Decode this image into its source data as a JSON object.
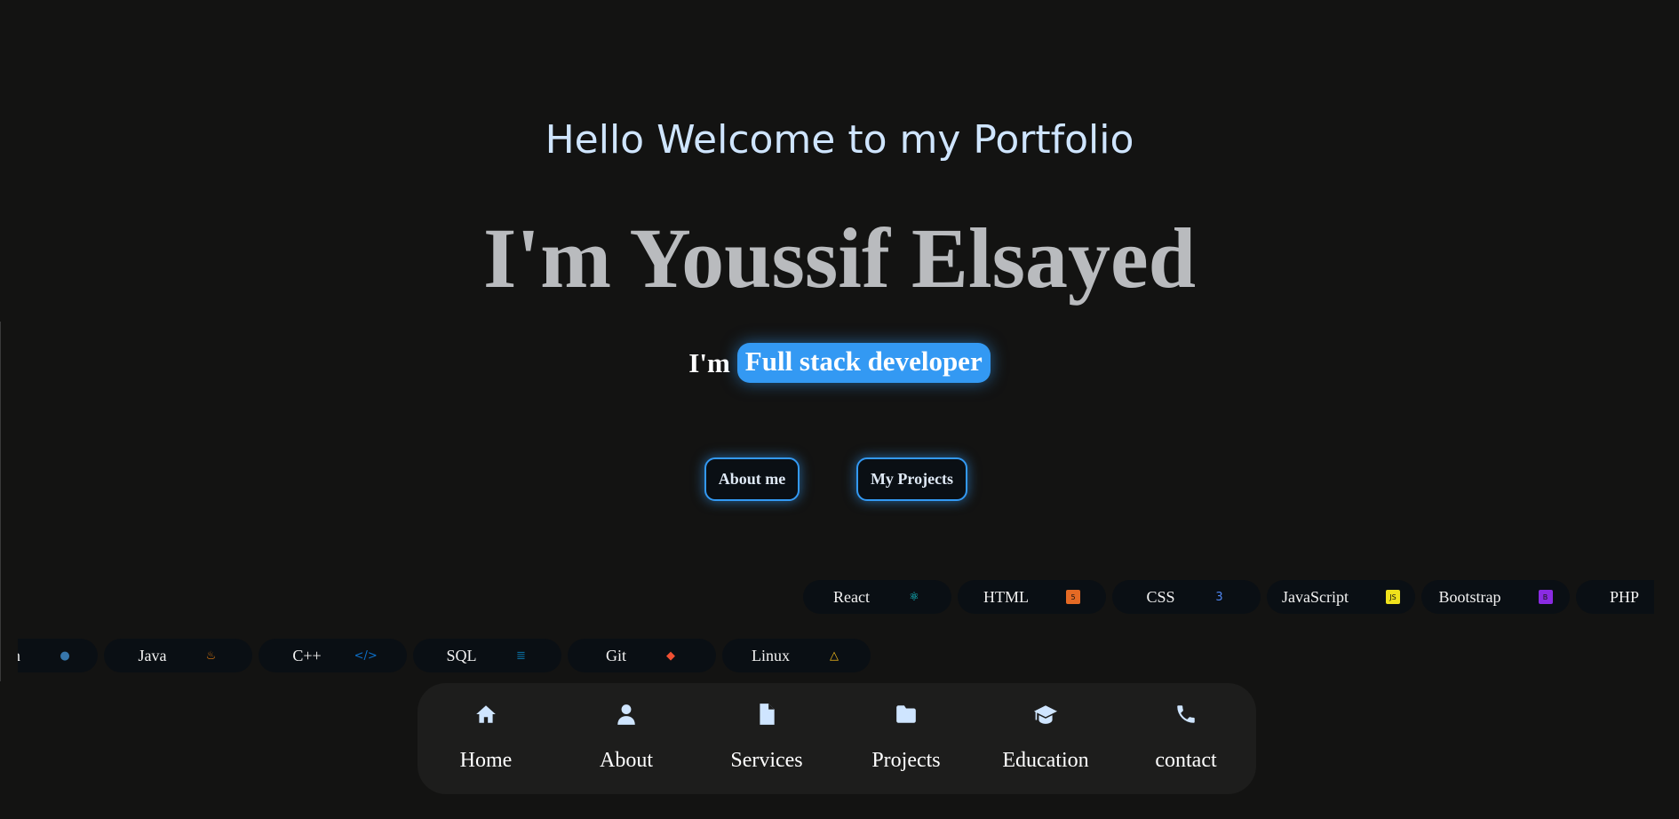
{
  "hero": {
    "greeting": "Hello Welcome to my Portfolio",
    "name": "I'm Youssif Elsayed",
    "role_prefix": "I'm",
    "role": "Full stack developer",
    "accent_color": "#3399f3"
  },
  "buttons": {
    "about": "About me",
    "projects": "My Projects"
  },
  "skills_row1": [
    {
      "label": "React",
      "icon": "react-icon",
      "color": "#16d9e3"
    },
    {
      "label": "HTML",
      "icon": "html5-icon",
      "color": "#e56a24"
    },
    {
      "label": "CSS",
      "icon": "css3-icon",
      "color": "#4f86f0"
    },
    {
      "label": "JavaScript",
      "icon": "js-icon",
      "color": "#f0e21c"
    },
    {
      "label": "Bootstrap",
      "icon": "bootstrap-icon",
      "color": "#8a2be2"
    },
    {
      "label": "PHP",
      "icon": "php-icon",
      "color": "#7a86b8"
    }
  ],
  "skills_row2": [
    {
      "label": "Python",
      "icon": "python-icon",
      "color": "#3776ab"
    },
    {
      "label": "Java",
      "icon": "java-icon",
      "color": "#e07a10"
    },
    {
      "label": "C++",
      "icon": "code-icon",
      "color": "#0d6fc8"
    },
    {
      "label": "SQL",
      "icon": "database-icon",
      "color": "#0a6a9a"
    },
    {
      "label": "Git",
      "icon": "git-icon",
      "color": "#f05033"
    },
    {
      "label": "Linux",
      "icon": "linux-icon",
      "color": "#f0b81c"
    }
  ],
  "nav": [
    {
      "label": "Home",
      "icon": "home-icon"
    },
    {
      "label": "About",
      "icon": "user-icon"
    },
    {
      "label": "Services",
      "icon": "file-icon"
    },
    {
      "label": "Projects",
      "icon": "folder-icon"
    },
    {
      "label": "Education",
      "icon": "graduation-cap-icon"
    },
    {
      "label": "contact",
      "icon": "phone-icon"
    }
  ]
}
